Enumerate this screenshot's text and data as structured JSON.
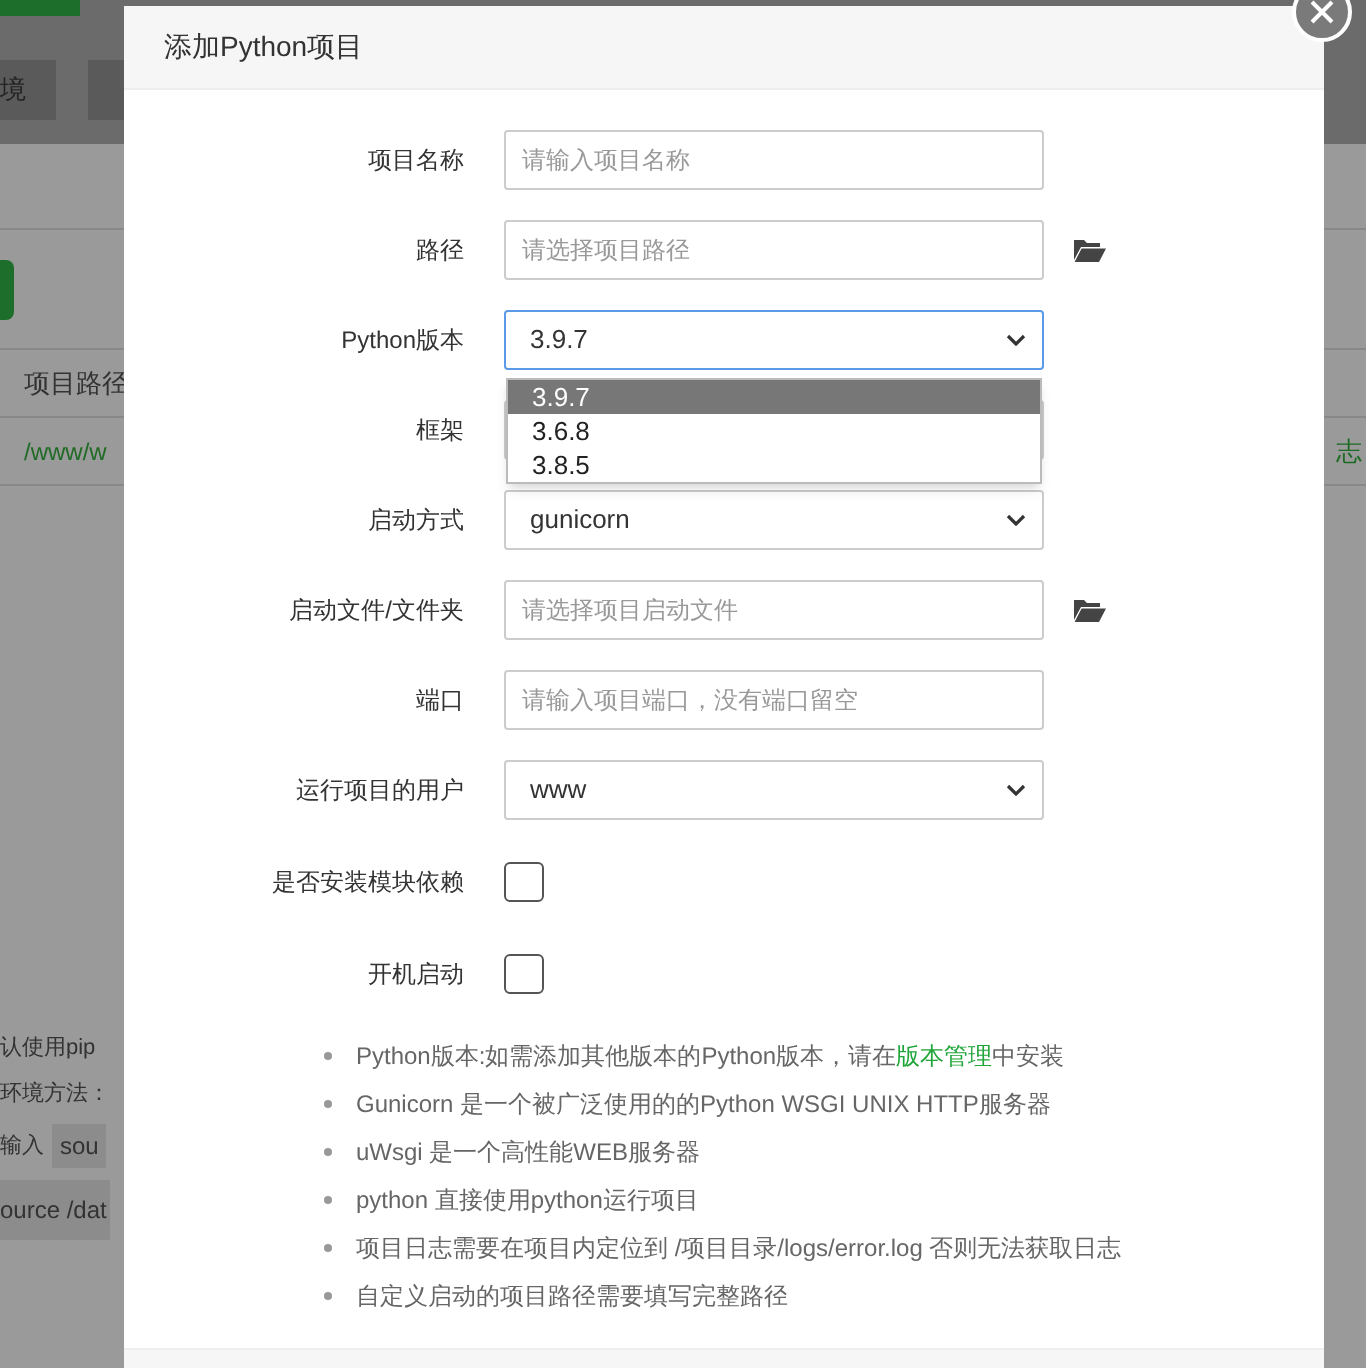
{
  "background": {
    "tab": "境",
    "table_header": "项目路径",
    "path_cell": "/www/w",
    "log_link": "志",
    "help_lines": [
      "认使用pip",
      "环境方法："
    ],
    "command_label": "输入",
    "command_code": "sou",
    "command_line": "ource /dat"
  },
  "dialog": {
    "title": "添加Python项目",
    "fields": [
      {
        "kind": "text",
        "label": "项目名称",
        "placeholder": "请输入项目名称"
      },
      {
        "kind": "text",
        "label": "路径",
        "placeholder": "请选择项目路径",
        "browse": true
      },
      {
        "kind": "select",
        "label": "Python版本",
        "value": "3.9.7",
        "open": true,
        "options": [
          {
            "label": "3.9.7",
            "selected": true
          },
          {
            "label": "3.6.8",
            "selected": false
          },
          {
            "label": "3.8.5",
            "selected": false
          }
        ]
      },
      {
        "kind": "select",
        "label": "框架"
      },
      {
        "kind": "select",
        "label": "启动方式",
        "value": "gunicorn"
      },
      {
        "kind": "text",
        "label": "启动文件/文件夹",
        "placeholder": "请选择项目启动文件",
        "browse": true
      },
      {
        "kind": "text",
        "label": "端口",
        "placeholder": "请输入项目端口，没有端口留空"
      },
      {
        "kind": "select",
        "label": "运行项目的用户",
        "value": "www"
      },
      {
        "kind": "checkbox",
        "label": "是否安装模块依赖",
        "checked": false
      },
      {
        "kind": "checkbox",
        "label": "开机启动",
        "checked": false
      }
    ],
    "notes": [
      [
        {
          "text": "Python版本:如需添加其他版本的Python版本，请在"
        },
        {
          "text": "版本管理",
          "link": true
        },
        {
          "text": "中安装"
        }
      ],
      [
        {
          "text": "Gunicorn 是一个被广泛使用的的Python WSGI UNIX HTTP服务器"
        }
      ],
      [
        {
          "text": "uWsgi 是一个高性能WEB服务器"
        }
      ],
      [
        {
          "text": "python 直接使用python运行项目"
        }
      ],
      [
        {
          "text": "项目日志需要在项目内定位到 /项目目录/logs/error.log 否则无法获取日志"
        }
      ],
      [
        {
          "text": "自定义启动的项目路径需要填写完整路径"
        }
      ]
    ]
  }
}
